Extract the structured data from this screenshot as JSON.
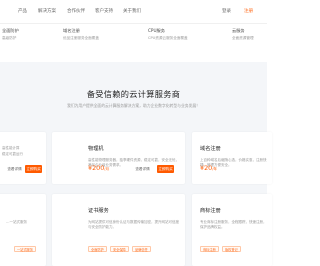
{
  "nav": {
    "items": [
      "产品",
      "解决方案",
      "合作伙伴",
      "客户支持",
      "关于我们"
    ],
    "login": "登录",
    "register": "注册"
  },
  "strip": [
    {
      "title": "全面防护",
      "desc": "高级防护"
    },
    {
      "title": "域名注册",
      "desc": "优品注册服务全面覆盖"
    },
    {
      "title": "CPU服务",
      "desc": "CPU资源云服务全面覆盖"
    },
    {
      "title": "云服务",
      "desc": "全面资源管理"
    }
  ],
  "section": {
    "title": "备受信赖的云计算服务商",
    "subtitle": "我们为用户提供全面的云计算服务解决方案，助力企业数字化转型与业务发展！"
  },
  "cards": {
    "left_top": {
      "desc_lines": [
        "高性能计算",
        "稳定可靠运行"
      ],
      "view": "查看详情",
      "buy": "立即购买"
    },
    "vm": {
      "title": "物理机",
      "desc": "高性能物理服务器，独享硬件资源，稳定可靠，安全无忧，满足企业级业务需求。",
      "price": "¥200",
      "unit": "/月",
      "view": "查看详情",
      "buy": "立即购买"
    },
    "domain": {
      "title": "域名注册",
      "desc": "上百种域名后缀随心选，价格实惠，注册快捷，管理方便安全。",
      "price": "¥20",
      "unit": "/年"
    },
    "left_bottom": {
      "desc_line": "…一站式服务",
      "tag": "一站式服务"
    },
    "ssl": {
      "title": "证书服务",
      "desc": "为网站提供可信身份认证与数据传输加密，提升网站可信度与安全防护能力。",
      "tags": [
        "全面防护",
        "安全保障",
        "品牌信任"
      ]
    },
    "trademark": {
      "title": "商标注册",
      "desc": "专业商标注册服务，全程跟踪，快速注册，保护品牌权益。",
      "tags": [
        "商标注册",
        "版权登记"
      ]
    }
  }
}
